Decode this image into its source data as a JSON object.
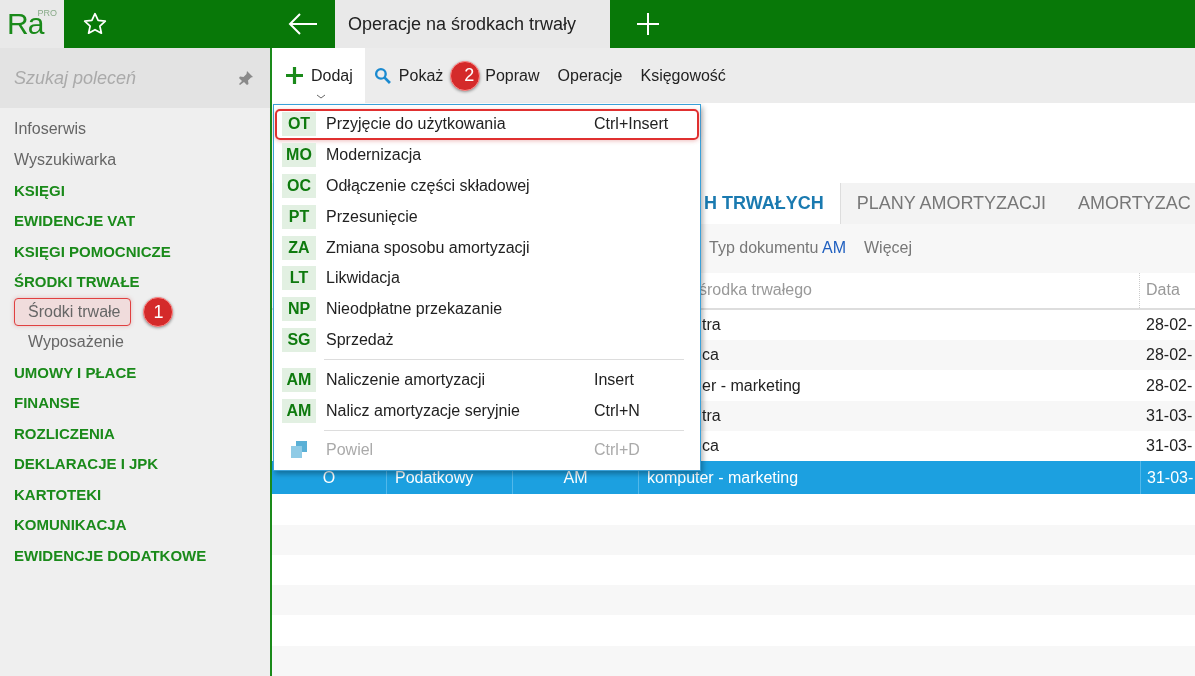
{
  "app": {
    "logo": "Ra",
    "edition": "PRO"
  },
  "document_tab": {
    "title": "Operacje na środkach trwały"
  },
  "sidebar": {
    "search": {
      "placeholder": "Szukaj poleceń"
    },
    "items": [
      {
        "label": "Infoserwis",
        "kind": "link",
        "selected": false
      },
      {
        "label": "Wyszukiwarka",
        "kind": "link",
        "selected": false
      },
      {
        "label": "KSIĘGI",
        "kind": "section",
        "selected": false
      },
      {
        "label": "EWIDENCJE VAT",
        "kind": "section",
        "selected": false
      },
      {
        "label": "KSIĘGI POMOCNICZE",
        "kind": "section",
        "selected": false
      },
      {
        "label": "ŚRODKI TRWAŁE",
        "kind": "section",
        "selected": false
      },
      {
        "label": "Środki trwałe",
        "kind": "sub",
        "selected": true,
        "annotation": "1"
      },
      {
        "label": "Wyposażenie",
        "kind": "sub",
        "selected": false
      },
      {
        "label": "UMOWY I PŁACE",
        "kind": "section",
        "selected": false
      },
      {
        "label": "FINANSE",
        "kind": "section",
        "selected": false
      },
      {
        "label": "ROZLICZENIA",
        "kind": "section",
        "selected": false
      },
      {
        "label": "DEKLARACJE I JPK",
        "kind": "section",
        "selected": false
      },
      {
        "label": "KARTOTEKI",
        "kind": "section",
        "selected": false
      },
      {
        "label": "KOMUNIKACJA",
        "kind": "section",
        "selected": false
      },
      {
        "label": "EWIDENCJE DODATKOWE",
        "kind": "section",
        "selected": false
      }
    ]
  },
  "toolbar": [
    {
      "label": "Dodaj",
      "kind": "add",
      "selected": true
    },
    {
      "label": "Pokaż",
      "kind": "show",
      "selected": false,
      "annotation": "2"
    },
    {
      "label": "Popraw",
      "kind": "plain",
      "selected": false
    },
    {
      "label": "Operacje",
      "kind": "plain",
      "selected": false
    },
    {
      "label": "Księgowość",
      "kind": "plain",
      "selected": false
    }
  ],
  "menu": [
    {
      "kind": "item",
      "code": "OT",
      "label": "Przyjęcie do użytkowania",
      "shortcut": "Ctrl+Insert",
      "highlighted": true,
      "disabled": false
    },
    {
      "kind": "item",
      "code": "MO",
      "label": "Modernizacja",
      "highlighted": false,
      "disabled": false
    },
    {
      "kind": "item",
      "code": "OC",
      "label": "Odłączenie części składowej",
      "highlighted": false,
      "disabled": false
    },
    {
      "kind": "item",
      "code": "PT",
      "label": "Przesunięcie",
      "highlighted": false,
      "disabled": false
    },
    {
      "kind": "item",
      "code": "ZA",
      "label": "Zmiana sposobu amortyzacji",
      "highlighted": false,
      "disabled": false
    },
    {
      "kind": "item",
      "code": "LT",
      "label": "Likwidacja",
      "highlighted": false,
      "disabled": false
    },
    {
      "kind": "item",
      "code": "NP",
      "label": "Nieodpłatne przekazanie",
      "highlighted": false,
      "disabled": false
    },
    {
      "kind": "item",
      "code": "SG",
      "label": "Sprzedaż",
      "highlighted": false,
      "disabled": false
    },
    {
      "kind": "separator"
    },
    {
      "kind": "item",
      "code": "AM",
      "label": "Naliczenie amortyzacji",
      "shortcut": "Insert",
      "highlighted": false,
      "disabled": false
    },
    {
      "kind": "item",
      "code": "AM",
      "label": "Nalicz amortyzacje seryjnie",
      "shortcut": "Ctrl+N",
      "highlighted": false,
      "disabled": false
    },
    {
      "kind": "separator"
    },
    {
      "kind": "copy",
      "label": "Powiel",
      "shortcut": "Ctrl+D",
      "highlighted": false,
      "disabled": true
    }
  ],
  "tabs": [
    {
      "label": "H TRWAŁYCH",
      "selected": true
    },
    {
      "label": "PLANY AMORTYZACJI",
      "selected": false
    },
    {
      "label": "AMORTYZAC",
      "selected": false
    }
  ],
  "filters": {
    "label": "Typ dokumentu",
    "value": "AM",
    "more": "Więcej"
  },
  "table": {
    "columns": [
      "środka trwałego",
      "Data"
    ],
    "rows": [
      {
        "name": "tra",
        "date": "28-02-",
        "selected": false
      },
      {
        "name": "ca",
        "date": "28-02-",
        "selected": false
      },
      {
        "name": "er - marketing",
        "date": "28-02-",
        "selected": false
      },
      {
        "name": "tra",
        "date": "31-03-",
        "selected": false
      },
      {
        "name": "ca",
        "date": "31-03-",
        "selected": false
      },
      {
        "column_1": "O",
        "column_2": "Podatkowy",
        "column_3": "AM",
        "name": "komputer - marketing",
        "date": "31-03-",
        "selected": true
      }
    ]
  }
}
